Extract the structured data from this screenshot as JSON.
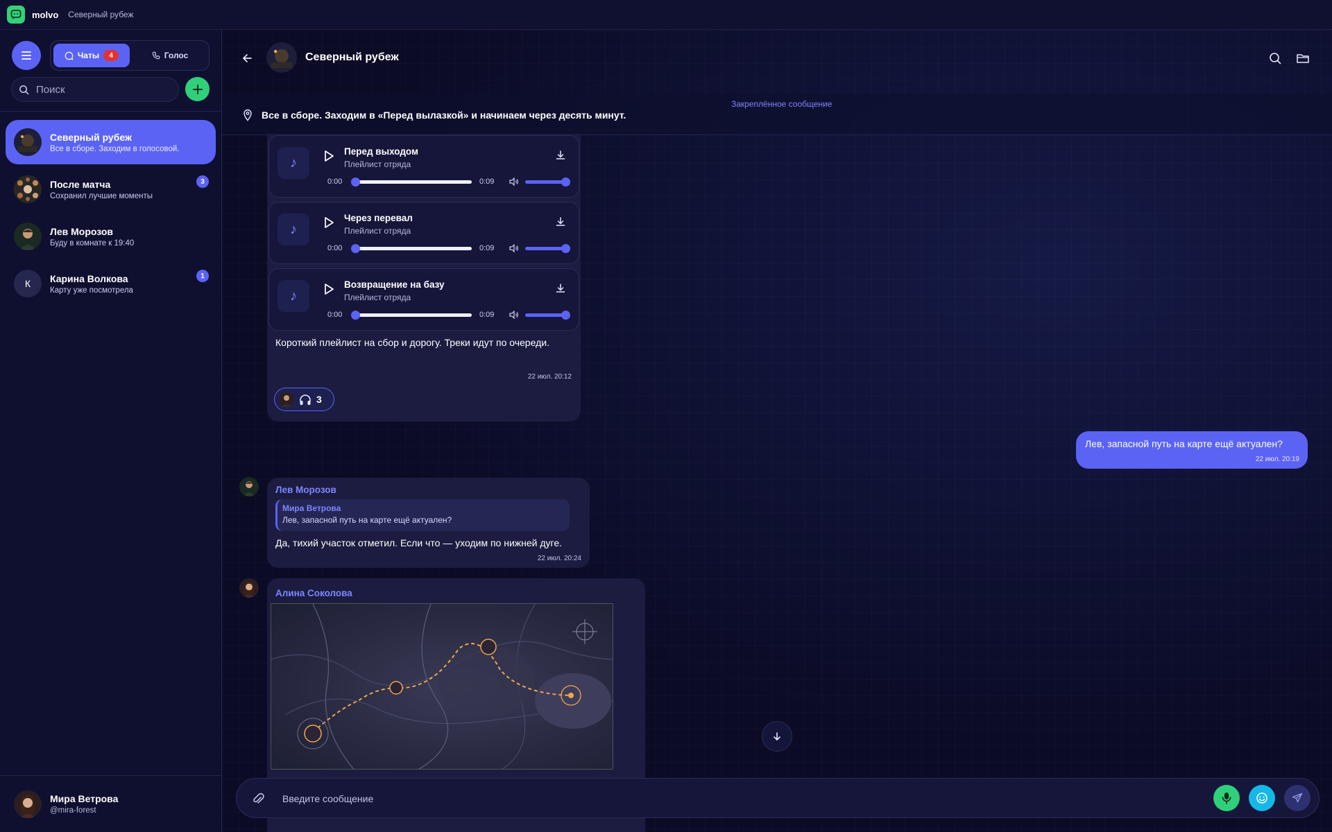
{
  "app": {
    "name": "molvo",
    "window_title": "Северный рубеж"
  },
  "sidebar": {
    "tabs": [
      {
        "label": "Чаты",
        "badge": "4",
        "icon": "chat-bubble-icon"
      },
      {
        "label": "Голос",
        "icon": "phone-icon"
      }
    ],
    "search_placeholder": "Поиск",
    "chats": [
      {
        "name": "Северный рубеж",
        "preview": "Все в сборе. Заходим в голосовой.",
        "active": true
      },
      {
        "name": "После матча",
        "preview": "Сохранил лучшие моменты",
        "unread": "3"
      },
      {
        "name": "Лев Морозов",
        "preview": "Буду в комнате к 19:40"
      },
      {
        "name": "Карина Волкова",
        "preview": "Карту уже посмотрела",
        "unread": "1",
        "initial": "К"
      }
    ],
    "profile": {
      "name": "Мира Ветрова",
      "handle": "@mira-forest"
    }
  },
  "chat": {
    "title": "Северный рубеж",
    "pinned": {
      "label": "Закреплённое сообщение",
      "text": "Все в сборе. Заходим в «Перед вылазкой» и начинаем через десять минут."
    },
    "tracks": [
      {
        "title": "Перед выходом",
        "subtitle": "Плейлист отряда",
        "current": "0:00",
        "duration": "0:09"
      },
      {
        "title": "Через перевал",
        "subtitle": "Плейлист отряда",
        "current": "0:00",
        "duration": "0:09"
      },
      {
        "title": "Возвращение на базу",
        "subtitle": "Плейлист отряда",
        "current": "0:00",
        "duration": "0:09"
      }
    ],
    "playlist_message": {
      "text": "Короткий плейлист на сбор и дорогу. Треки идут по очереди.",
      "time": "22 июл. 20:12",
      "reaction_icon": "headphones-icon",
      "reaction_count": "3"
    },
    "outgoing": {
      "text": "Лев, запасной путь на карте ещё актуален?",
      "time": "22 июл. 20:19"
    },
    "reply_message": {
      "sender": "Лев Морозов",
      "quote_author": "Мира Ветрова",
      "quote_text": "Лев, запасной путь на карте ещё актуален?",
      "text": "Да, тихий участок отметил. Если что — уходим по нижней дуге.",
      "time": "22 июл. 20:24"
    },
    "map_message": {
      "sender": "Алина Соколова"
    },
    "composer": {
      "placeholder": "Введите сообщение"
    }
  },
  "colors": {
    "accent": "#5b63f5",
    "green": "#30d07a",
    "cyan": "#16b7e8",
    "background": "#0b0b26"
  }
}
